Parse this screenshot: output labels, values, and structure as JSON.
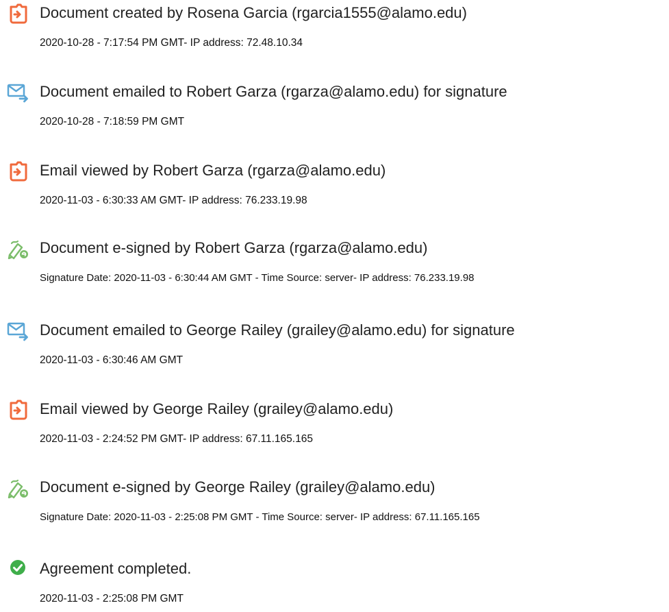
{
  "colors": {
    "document_icon": "#f06a3c",
    "email_icon": "#5aa6d6",
    "sign_icon": "#7bbd6a",
    "complete_icon": "#3fae4a"
  },
  "events": [
    {
      "icon": "document-icon",
      "title": "Document created by Rosena Garcia (rgarcia1555@alamo.edu)",
      "detail": "2020-10-28 - 7:17:54 PM GMT- IP address: 72.48.10.34"
    },
    {
      "icon": "email-icon",
      "title": "Document emailed to Robert Garza (rgarza@alamo.edu) for signature",
      "detail": "2020-10-28 - 7:18:59 PM GMT"
    },
    {
      "icon": "document-icon",
      "title": "Email viewed by Robert Garza (rgarza@alamo.edu)",
      "detail": "2020-11-03 - 6:30:33 AM GMT- IP address: 76.233.19.98"
    },
    {
      "icon": "e-sign-icon",
      "title": "Document e-signed by Robert Garza (rgarza@alamo.edu)",
      "detail": "Signature Date: 2020-11-03 - 6:30:44 AM GMT - Time Source: server- IP address: 76.233.19.98"
    },
    {
      "icon": "email-icon",
      "title": "Document emailed to George Railey (grailey@alamo.edu) for signature",
      "detail": "2020-11-03 - 6:30:46 AM GMT"
    },
    {
      "icon": "document-icon",
      "title": "Email viewed by George Railey (grailey@alamo.edu)",
      "detail": "2020-11-03 - 2:24:52 PM GMT- IP address: 67.11.165.165"
    },
    {
      "icon": "e-sign-icon",
      "title": "Document e-signed by George Railey (grailey@alamo.edu)",
      "detail": "Signature Date: 2020-11-03 - 2:25:08 PM GMT - Time Source: server- IP address: 67.11.165.165"
    },
    {
      "icon": "checkmark-icon",
      "title": "Agreement completed.",
      "detail": "2020-11-03 - 2:25:08 PM GMT"
    }
  ]
}
